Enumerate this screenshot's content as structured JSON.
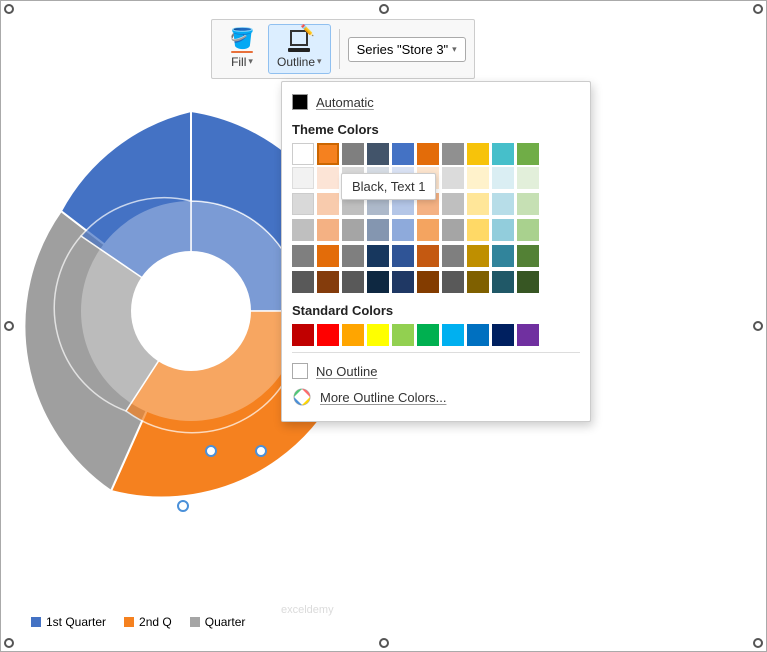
{
  "toolbar": {
    "fill_label": "Fill",
    "outline_label": "Outline",
    "series_label": "Series \"Store 3\"",
    "caret": "▾"
  },
  "colorpicker": {
    "automatic_label": "Automatic",
    "theme_colors_title": "Theme Colors",
    "standard_colors_title": "Standard Colors",
    "no_outline_label": "No Outline",
    "more_colors_label": "More Outline Colors...",
    "tooltip_text": "Black, Text 1",
    "theme_row1": [
      "#ffffff",
      "#f5811f",
      "#7f7f7f",
      "#42546a",
      "#4472c4",
      "#e36c09",
      "#909090",
      "#f7c30a",
      "#46bfca",
      "#70ad47"
    ],
    "tint_rows": [
      [
        "#f2f2f2",
        "#fce4d6",
        "#d8d8d8",
        "#d6dce4",
        "#d9e2f3",
        "#fce4cd",
        "#dbdbdb",
        "#fff2cb",
        "#daeef3",
        "#e2efda"
      ],
      [
        "#d9d9d9",
        "#f8cbad",
        "#bfbfbf",
        "#adb9ca",
        "#b4c6e7",
        "#f4b183",
        "#bfbfbf",
        "#ffe699",
        "#b7dde8",
        "#c6e0b4"
      ],
      [
        "#bfbfbf",
        "#f4b183",
        "#a5a5a5",
        "#8496b0",
        "#8eaadb",
        "#f4a460",
        "#a5a5a5",
        "#ffd966",
        "#92cddc",
        "#a9d18e"
      ],
      [
        "#7f7f7f",
        "#e36c09",
        "#7f7f7f",
        "#17375e",
        "#2f5496",
        "#c45911",
        "#7f7f7f",
        "#bf8f00",
        "#31849b",
        "#538135"
      ],
      [
        "#595959",
        "#843c0c",
        "#595959",
        "#0e2841",
        "#1f3864",
        "#833c00",
        "#595959",
        "#7f6000",
        "#205867",
        "#375623"
      ]
    ],
    "standard_colors": [
      "#ff0000",
      "#ee1111",
      "#ffa500",
      "#ffff00",
      "#92d050",
      "#00b050",
      "#00b0f0",
      "#0070c0",
      "#002060",
      "#7030a0"
    ]
  },
  "legend": {
    "items": [
      {
        "label": "1st Quarter",
        "color": "#4472c4"
      },
      {
        "label": "2nd Q",
        "color": "#f5811f"
      },
      {
        "label": "Quarter",
        "color": "#a5a5a5"
      }
    ]
  },
  "watermark": "exceldemy"
}
